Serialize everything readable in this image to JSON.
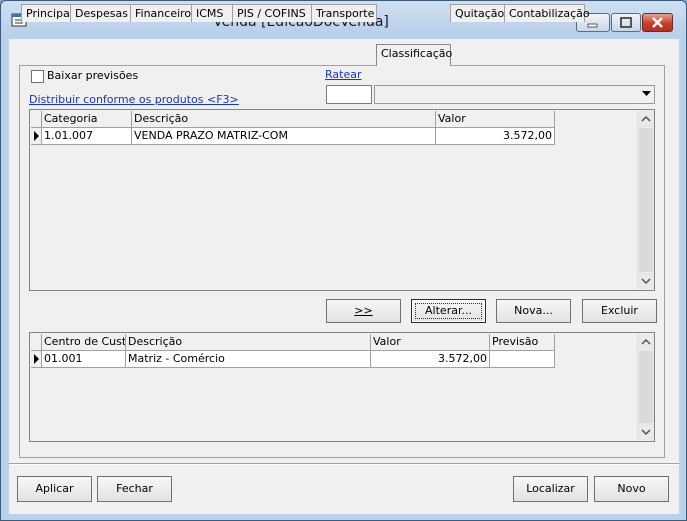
{
  "window": {
    "title": "Venda [EdicaoDocVenda]"
  },
  "tabs": [
    {
      "label": "Principal"
    },
    {
      "label": "Despesas"
    },
    {
      "label": "Financeiro"
    },
    {
      "label": "ICMS"
    },
    {
      "label": "PIS / COFINS"
    },
    {
      "label": "Transporte"
    },
    {
      "label": "Classificação"
    },
    {
      "label": "Quitação"
    },
    {
      "label": "Contabilização"
    }
  ],
  "active_tab": "Classificação",
  "options": {
    "baixar_previsoes": "Baixar previsões",
    "baixar_previsoes_checked": false,
    "ratear_link": "Ratear",
    "distribuir_link": "Distribuir conforme os produtos <F3>",
    "ratear_code_value": "",
    "ratear_combo_value": ""
  },
  "grid_categoria": {
    "columns": [
      "Categoria",
      "Descrição",
      "Valor"
    ],
    "rows": [
      {
        "categoria": "1.01.007",
        "descricao": "VENDA PRAZO MATRIZ-COM",
        "valor": "3.572,00"
      }
    ]
  },
  "middle_buttons": {
    "transfer": ">>",
    "alterar": "Alterar...",
    "nova": "Nova...",
    "excluir": "Excluir"
  },
  "grid_centro": {
    "columns": [
      "Centro de Custo",
      "Descrição",
      "Valor",
      "Previsão"
    ],
    "rows": [
      {
        "centro": "01.001",
        "descricao": "Matriz - Comércio",
        "valor": "3.572,00",
        "previsao": ""
      }
    ]
  },
  "footer": {
    "aplicar": "Aplicar",
    "fechar": "Fechar",
    "localizar": "Localizar",
    "novo": "Novo"
  },
  "icons": {
    "app": "document-window-icon",
    "minimize": "minimize-icon",
    "maximize": "maximize-icon",
    "close": "close-icon"
  }
}
